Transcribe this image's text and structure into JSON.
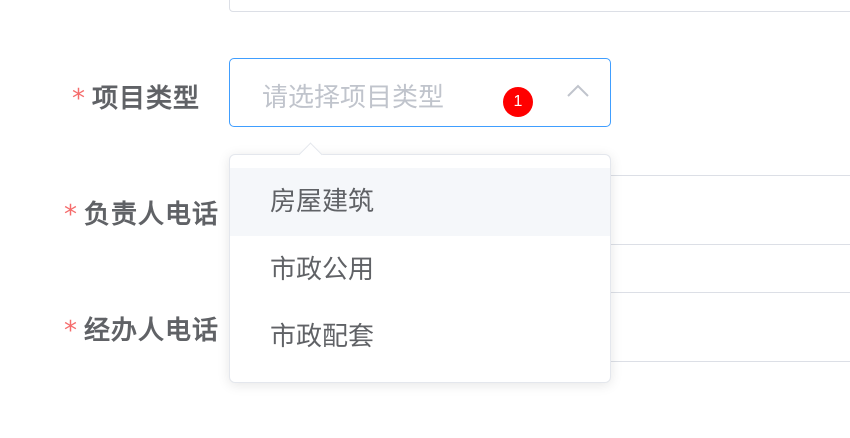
{
  "form": {
    "project_type": {
      "required_mark": "*",
      "label": "项目类型",
      "placeholder": "请选择项目类型",
      "badge": "1",
      "options": [
        "房屋建筑",
        "市政公用",
        "市政配套"
      ]
    },
    "manager_phone": {
      "required_mark": "*",
      "label": "负责人电话"
    },
    "agent_phone": {
      "required_mark": "*",
      "label": "经办人电话"
    }
  },
  "colors": {
    "required": "#f56c6c",
    "focus_border": "#409eff",
    "badge": "#ff0000",
    "placeholder": "#c0c4cc"
  },
  "icons": {
    "select_arrow": "chevron-up-icon"
  }
}
